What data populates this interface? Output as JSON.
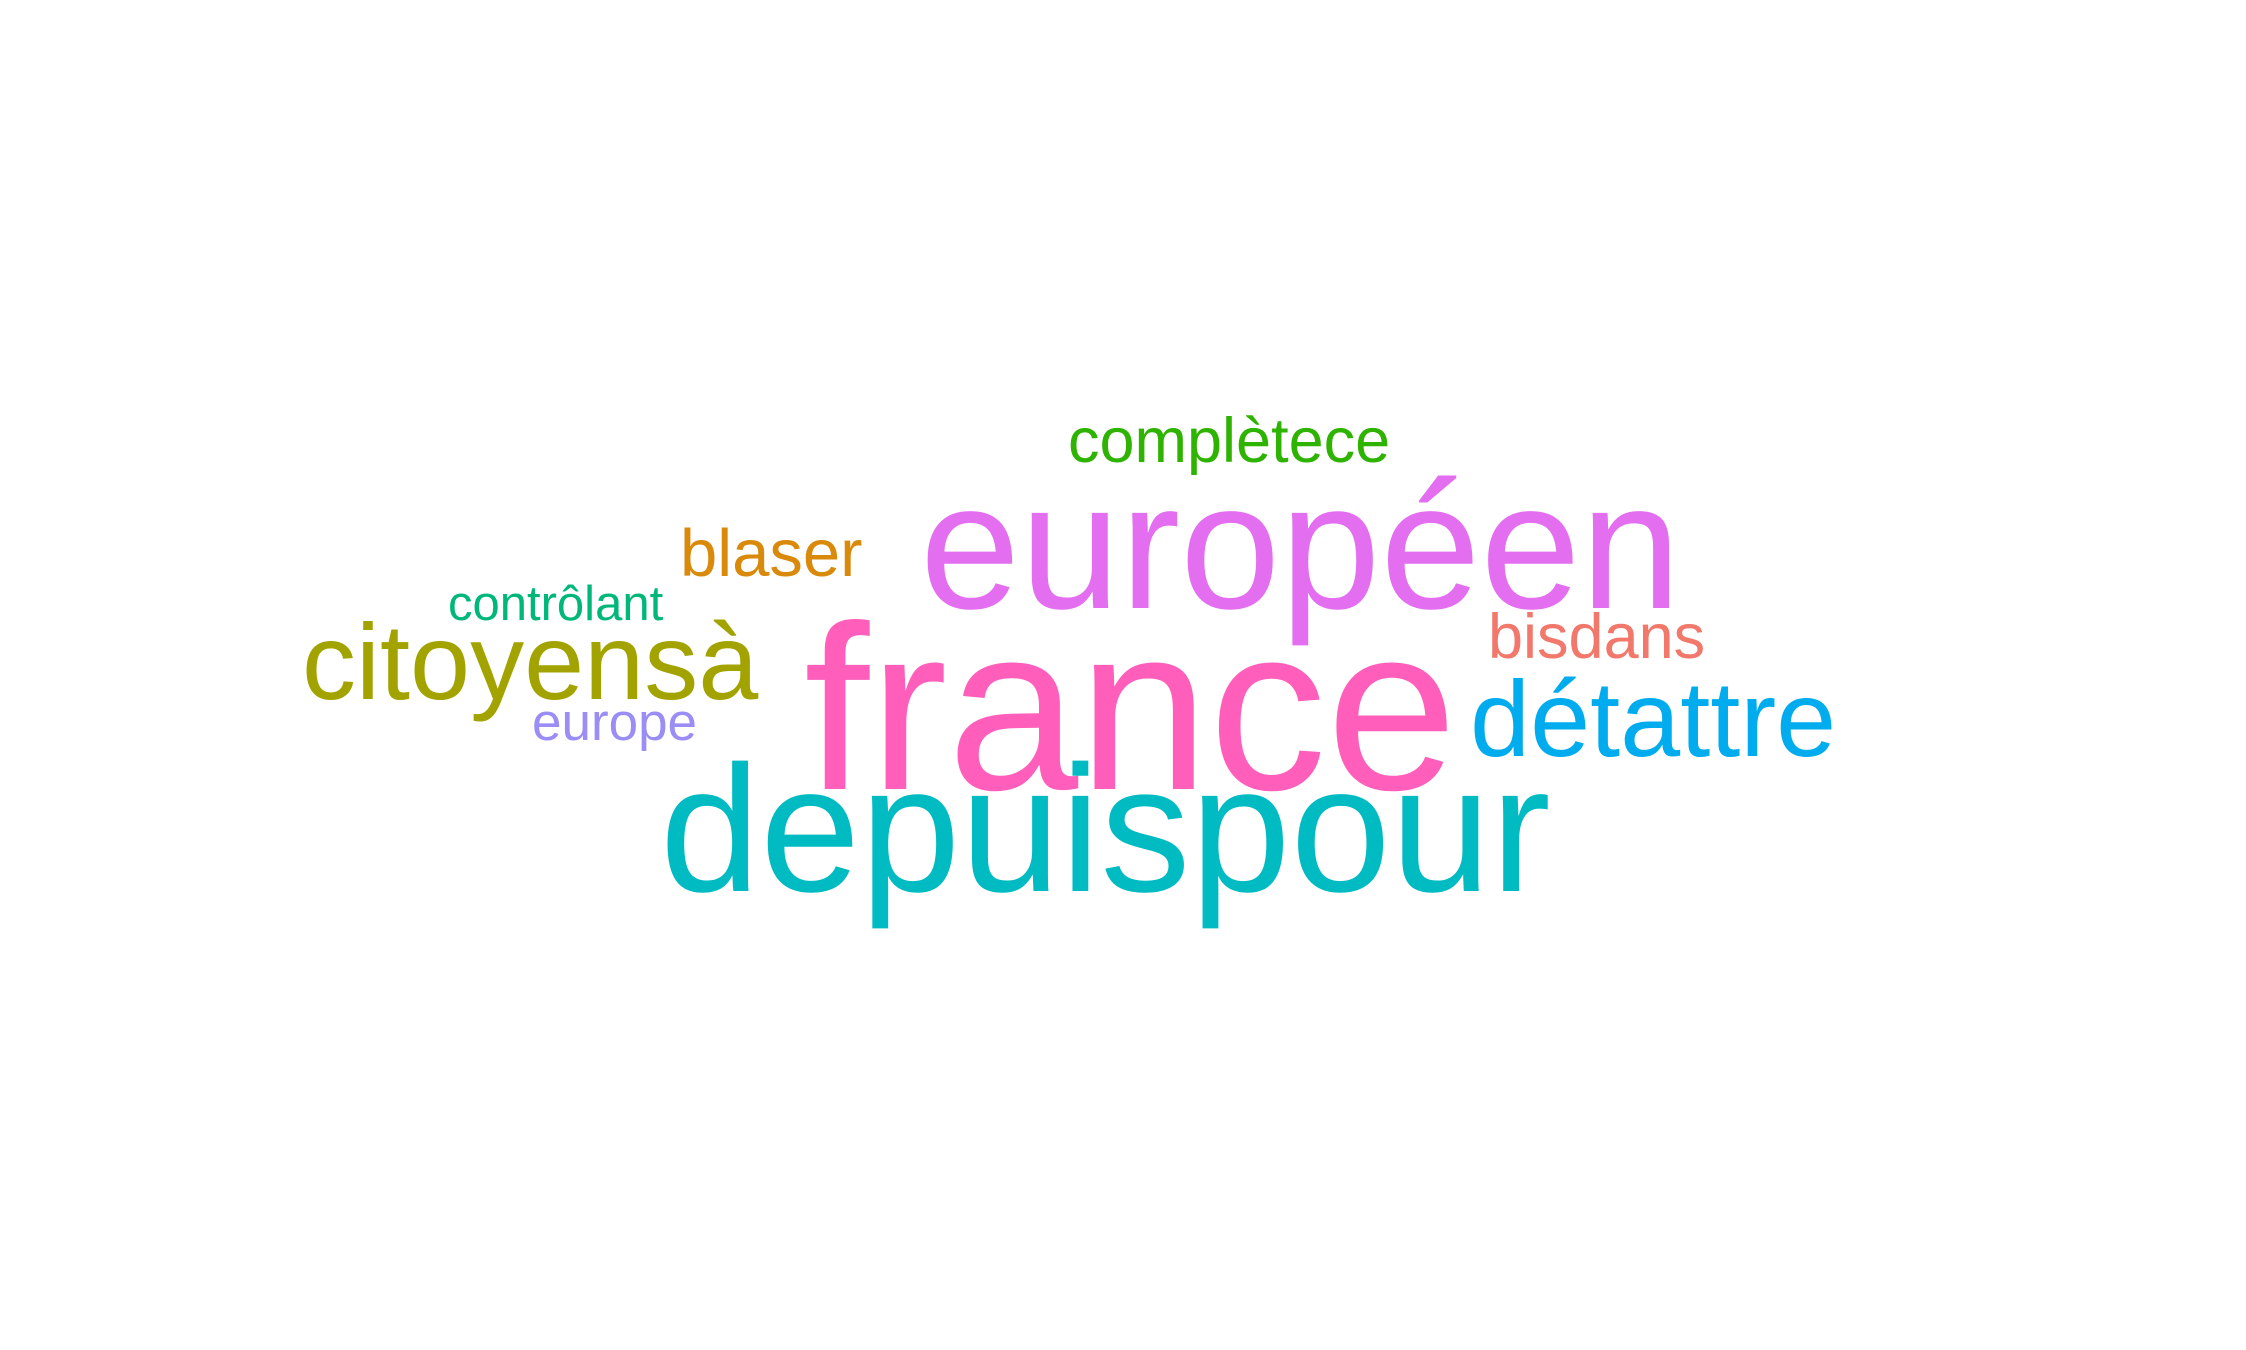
{
  "cloud": {
    "words": [
      {
        "id": "completece",
        "text": "complètece",
        "color": "#2db300"
      },
      {
        "id": "europeen",
        "text": "européen",
        "color": "#e36ef0"
      },
      {
        "id": "blaser",
        "text": "blaser",
        "color": "#d98a0b"
      },
      {
        "id": "controlant",
        "text": "contrôlant",
        "color": "#00b77a"
      },
      {
        "id": "citoyensa",
        "text": "citoyensà",
        "color": "#a3a300"
      },
      {
        "id": "france",
        "text": "france",
        "color": "#ff5fbb"
      },
      {
        "id": "bisdans",
        "text": "bisdans",
        "color": "#f1786b"
      },
      {
        "id": "detattre",
        "text": "détattre",
        "color": "#00acee"
      },
      {
        "id": "europe",
        "text": "europe",
        "color": "#9a8df5"
      },
      {
        "id": "depuispour",
        "text": "depuispour",
        "color": "#00bbc2"
      }
    ]
  }
}
